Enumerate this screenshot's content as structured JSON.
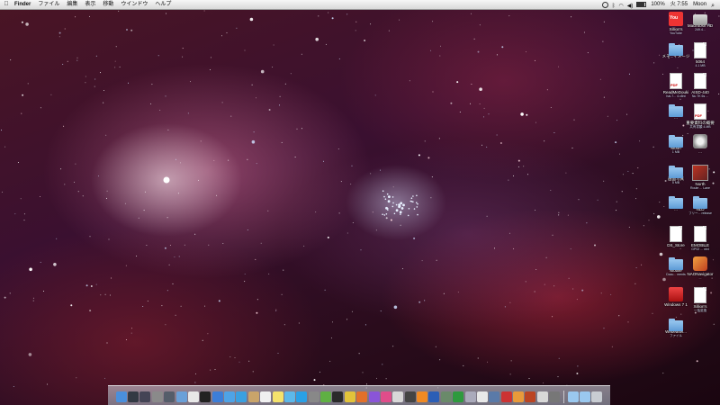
{
  "menubar": {
    "apple": "",
    "items": [
      {
        "label": "Finder",
        "bold": true
      },
      {
        "label": "ファイル"
      },
      {
        "label": "編集"
      },
      {
        "label": "表示"
      },
      {
        "label": "移動"
      },
      {
        "label": "ウインドウ"
      },
      {
        "label": "ヘルプ"
      }
    ],
    "battery": "100%",
    "clock": "火 7:55",
    "user": "Moon"
  },
  "desktop_icons": [
    {
      "name": "youtube",
      "label": "Xillion's",
      "sub": "YouTube",
      "glyph": "yt"
    },
    {
      "name": "macintosh-hd",
      "label": "Macintosh HD",
      "sub": "249.4...",
      "glyph": "hd"
    },
    {
      "name": "folder-1",
      "label": "メモ...イメージ",
      "sub": "",
      "glyph": "folder"
    },
    {
      "name": "doc-5064",
      "label": "5064",
      "sub": "4.1 MB",
      "glyph": "doc"
    },
    {
      "name": "pdf-1",
      "label": "ReadMeDouki",
      "sub": "hai-7... 4.x8nt",
      "glyph": "pdf"
    },
    {
      "name": "doc-aisd",
      "label": "AISD-440",
      "sub": "Nu 7K 6s ...",
      "glyph": "doc"
    },
    {
      "name": "folder-2",
      "label": "...",
      "sub": "",
      "glyph": "folder"
    },
    {
      "name": "pdf-2",
      "label": "重要資料の概要",
      "sub": "共有書類 4.MB",
      "glyph": "pdf"
    },
    {
      "name": "folder-moon",
      "label": "Moon",
      "sub": "1 MB",
      "glyph": "folder"
    },
    {
      "name": "dmg-1",
      "label": "...",
      "sub": "",
      "glyph": "dmg"
    },
    {
      "name": "folder-3",
      "label": "画面写真",
      "sub": "5 MB",
      "glyph": "folder"
    },
    {
      "name": "img-north",
      "label": "North",
      "sub": "Route ... Lane",
      "glyph": "img"
    },
    {
      "name": "folder-4",
      "label": "...",
      "sub": "",
      "glyph": "folder"
    },
    {
      "name": "folder-5",
      "label": "NLD",
      "sub": "フリー... release",
      "glyph": "folder"
    },
    {
      "name": "doc-dsstore",
      "label": "DS_Store",
      "sub": "",
      "glyph": "doc"
    },
    {
      "name": "doc-emobile",
      "label": "EMOBILE",
      "sub": "GP02 ... ntxt",
      "glyph": "doc"
    },
    {
      "name": "folder-mobile",
      "label": "Mobile",
      "sub": "Docu... ments",
      "glyph": "folder"
    },
    {
      "name": "app-navigator",
      "label": "NAONavigator",
      "sub": "...",
      "glyph": "app"
    },
    {
      "name": "windows-7",
      "label": "Windows 7 1",
      "sub": "",
      "glyph": "red"
    },
    {
      "name": "doc-xillion",
      "label": "Xillion's",
      "sub": "一括変換",
      "glyph": "doc"
    },
    {
      "name": "folder-webeasel",
      "label": "Webeasel...",
      "sub": "ファイル",
      "glyph": "folder"
    }
  ],
  "dock": {
    "items": [
      {
        "name": "finder",
        "color": "#4a8fdc"
      },
      {
        "name": "dashboard",
        "color": "#333a44"
      },
      {
        "name": "mission-control",
        "color": "#445"
      },
      {
        "name": "system-preferences",
        "color": "#8a8a8a"
      },
      {
        "name": "launchpad",
        "color": "#555d6a"
      },
      {
        "name": "mail",
        "color": "#6aa0d8"
      },
      {
        "name": "ical",
        "color": "#e8e8e8"
      },
      {
        "name": "terminal",
        "color": "#222"
      },
      {
        "name": "app-store",
        "color": "#3c7ed8"
      },
      {
        "name": "safari",
        "color": "#4ea3e6"
      },
      {
        "name": "itunes",
        "color": "#3aa0e0"
      },
      {
        "name": "address-book",
        "color": "#c9a46a"
      },
      {
        "name": "textedit",
        "color": "#f0f0f0"
      },
      {
        "name": "stickies",
        "color": "#f4e26c"
      },
      {
        "name": "twitter",
        "color": "#5cb8ea"
      },
      {
        "name": "skype",
        "color": "#2aa0e6"
      },
      {
        "name": "keychain",
        "color": "#888"
      },
      {
        "name": "evernote",
        "color": "#5fb043"
      },
      {
        "name": "activity-monitor",
        "color": "#2a2a2a"
      },
      {
        "name": "chrome",
        "color": "#e2c33a"
      },
      {
        "name": "firefox",
        "color": "#e2702a"
      },
      {
        "name": "itunes-2",
        "color": "#8a55d8"
      },
      {
        "name": "flower-app",
        "color": "#e04d8a"
      },
      {
        "name": "photo-app",
        "color": "#d8d8d8"
      },
      {
        "name": "game-app",
        "color": "#444"
      },
      {
        "name": "vlc",
        "color": "#f08a24"
      },
      {
        "name": "word",
        "color": "#2b5eb6"
      },
      {
        "name": "facetime",
        "color": "#6a8a6a"
      },
      {
        "name": "excel",
        "color": "#2e9a3e"
      },
      {
        "name": "preview",
        "color": "#aab"
      },
      {
        "name": "ical-2",
        "color": "#e8e8e8"
      },
      {
        "name": "quicktime",
        "color": "#5a7aa8"
      },
      {
        "name": "dvd",
        "color": "#cc3333"
      },
      {
        "name": "colorsync",
        "color": "#e89a3a"
      },
      {
        "name": "photoshop",
        "color": "#bb4422"
      },
      {
        "name": "script",
        "color": "#d8d8d8"
      },
      {
        "name": "utilities",
        "color": "#777"
      }
    ],
    "right_items": [
      {
        "name": "downloads-stack",
        "color": "#9ac8ef"
      },
      {
        "name": "documents-stack",
        "color": "#9ac8ef"
      },
      {
        "name": "trash",
        "color": "#c8ccd2"
      }
    ]
  }
}
